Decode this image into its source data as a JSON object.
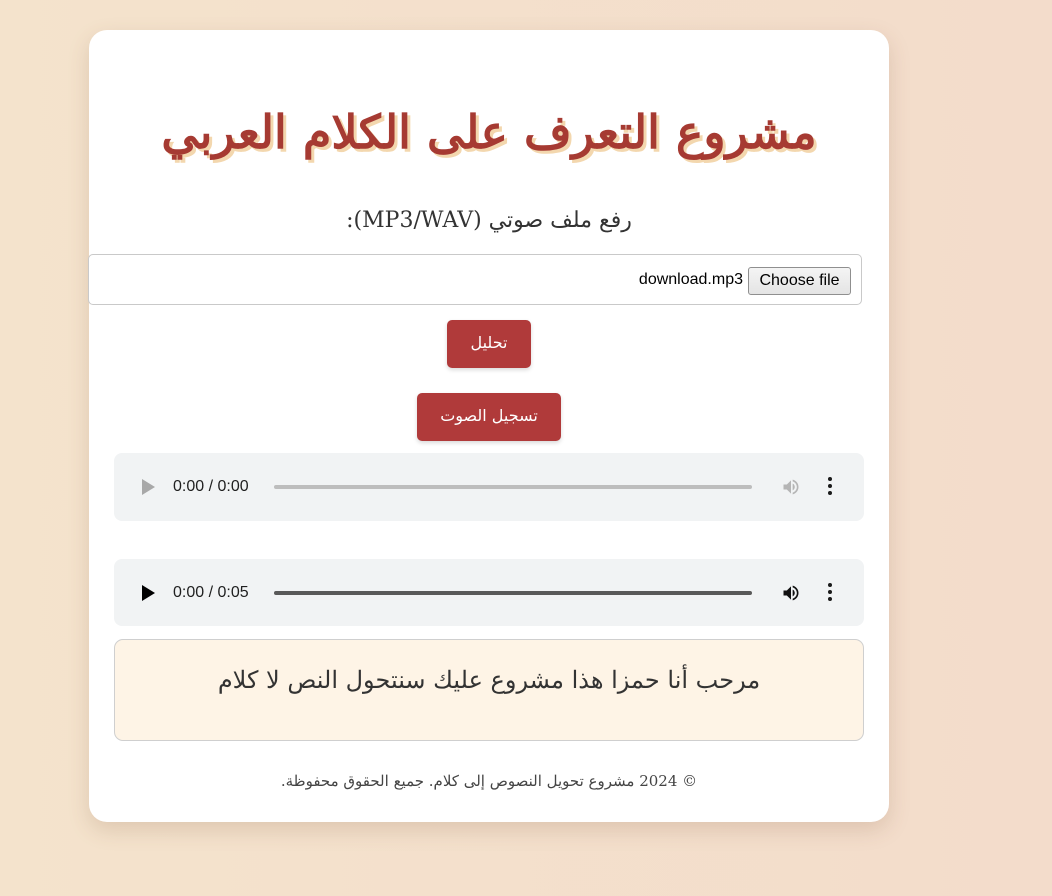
{
  "header": {
    "title": "مشروع التعرف على الكلام العربي"
  },
  "upload": {
    "label": "رفع ملف صوتي (MP3/WAV):",
    "choose_button": "Choose file",
    "file_name": "download.mp3"
  },
  "actions": {
    "analyze_label": "تحليل",
    "record_label": "تسجيل الصوت"
  },
  "players": [
    {
      "time": "0:00 / 0:00",
      "progress": 0,
      "enabled": false
    },
    {
      "time": "0:00 / 0:05",
      "progress": 0,
      "enabled": true
    }
  ],
  "result": {
    "text": "مرحب أنا حمزا هذا مشروع عليك سنتحول النص لا كلام"
  },
  "footer": {
    "text": "© 2024 مشروع تحويل النصوص إلى كلام. جميع الحقوق محفوظة."
  },
  "colors": {
    "accent": "#b03a3a",
    "title": "#a63a32",
    "result_bg": "#fef4e6"
  },
  "icons": {
    "play": "play-icon",
    "volume": "volume-icon",
    "more": "more-vertical-icon"
  }
}
